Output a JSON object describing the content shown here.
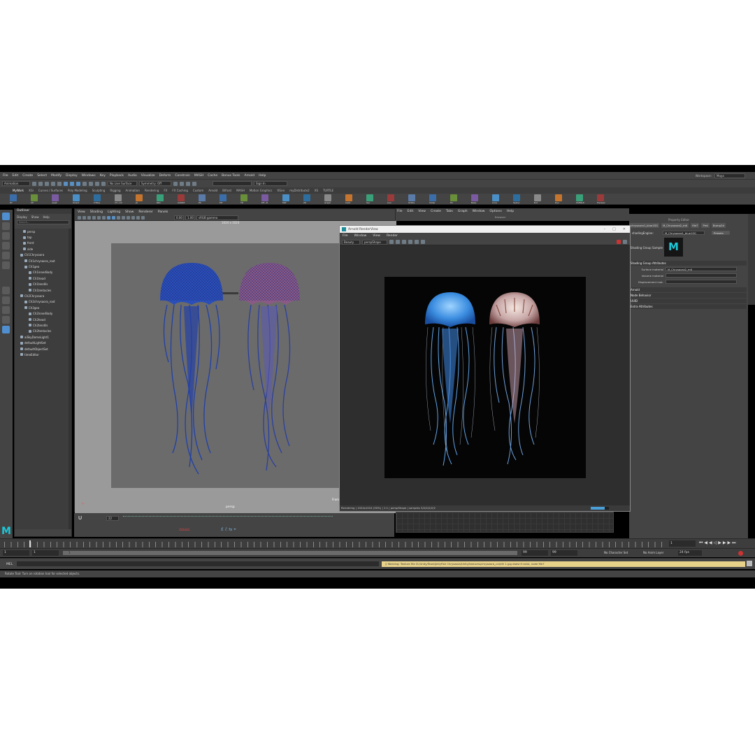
{
  "menubar": [
    "File",
    "Edit",
    "Create",
    "Select",
    "Modify",
    "Display",
    "Windows",
    "Key",
    "Playback",
    "Audio",
    "Visualize",
    "Deform",
    "Constrain",
    "MASH",
    "Cache",
    "Bonus Tools",
    "Arnold",
    "Help"
  ],
  "workspace": {
    "label": "Workspace:",
    "value": "Maya"
  },
  "status_line": {
    "mode": "Animation",
    "live_surface": "No Live Surface",
    "symmetry": "Symmetry: Off",
    "sign_in": "Sign In"
  },
  "shelf_tabs": [
    "MyWork",
    "XGi",
    "Curves / Surfaces",
    "Poly Modeling",
    "Sculpting",
    "Rigging",
    "Animation",
    "Rendering",
    "FX",
    "FX Caching",
    "Custom",
    "Arnold",
    "Bifrost",
    "MASH",
    "Motion Graphics",
    "XGen",
    "myDistribute2",
    "XS",
    "TURTLE"
  ],
  "shelf_labels": [
    "87",
    "CP",
    "reset",
    "Orient",
    "CTRLs",
    "CV~CV",
    "JX",
    "Rfix",
    "CONST",
    "PS",
    "MT",
    "TR",
    "MT~R",
    "MLT",
    "28",
    "Graph",
    "CalcI",
    "Sel",
    "Con",
    "Orbits",
    "Slider",
    "Fin",
    "Bake",
    "Core",
    "Spline",
    "B-U",
    "Dyn",
    "OVERLE",
    "Hanked"
  ],
  "outliner": {
    "title": "Outliner",
    "menu": [
      "Display",
      "Show",
      "Help"
    ],
    "search_placeholder": "Search...",
    "items": [
      "persp",
      "top",
      "front",
      "side",
      "Ch1Chrysaora",
      "Ch1chrysaora_root",
      "Ch1geo",
      "Ch1innerBody",
      "Ch1head",
      "Ch1tendils",
      "Ch1tentacles",
      "Ch2Chrysaora",
      "Ch2chrysaora_root",
      "Ch2geo",
      "Ch2innerBody",
      "Ch2head",
      "Ch2tendils",
      "Ch2tentacles",
      "aiSkyDomeLight1",
      "defaultLightSet",
      "defaultObjectSet",
      "timeEditor"
    ]
  },
  "viewport": {
    "menu": [
      "View",
      "Shading",
      "Lighting",
      "Show",
      "Renderer",
      "Panels"
    ],
    "resolution": "1024 x 1024",
    "gamma_fields": [
      "0.00",
      "1.00"
    ],
    "colorspace": "sRGB gamma",
    "camera": "persp",
    "frame_label": "Frame:"
  },
  "render_view": {
    "title": "Arnold RenderView",
    "menu": [
      "File",
      "Window",
      "View",
      "Render"
    ],
    "aov": "Beauty",
    "camera": "perspShape",
    "status": "Rendering | 1024x1024 (50%) | 1:1 | perspShape | samples 3/2/2/2/2/2",
    "progress": 0.75,
    "progress_label": "75%"
  },
  "hypershade_menu": [
    "File",
    "Edit",
    "View",
    "Create",
    "Tabs",
    "Graph",
    "Window",
    "Options",
    "Help"
  ],
  "hypershade_label": "Browser",
  "attribute_editor": {
    "title": "Property Editor",
    "tabs": [
      "chrysaora1_blue1SG",
      "M_Chrysaora2_mtl",
      "file7",
      "Pmt",
      "Bump2d"
    ],
    "shading_engine_label": "shadingEngine:",
    "shading_engine_value": "M_Chrysaora1_blue1SG",
    "presets": "Presets",
    "sample_label": "Shading Group Sample",
    "logo": "M",
    "section_sg": "Shading Group Attributes",
    "surface_label": "Surface material",
    "surface_value": "M_Chrysaora2_mtl",
    "volume_label": "Volume material",
    "volume_value": "",
    "displacement_label": "Displacement mat.",
    "displacement_value": "",
    "sections": [
      "Arnold",
      "Node Behavior",
      "UUID",
      "Extra Attributes"
    ]
  },
  "timeline": {
    "current_frame": "1",
    "frame_field": "22",
    "range_start": "1",
    "range_start2": "1",
    "range_mid": "1",
    "range_end_inner": "99",
    "range_end": "99",
    "range_end_outer": "99",
    "character_set": "No Character Set",
    "anim_layer": "No Anim Layer",
    "fps": "24 fps"
  },
  "command_line": {
    "lang": "MEL",
    "warning": "// Warning: Texture file D:/Unity/Store/JellyFish Chrysaora/Unity/textures/chrysaora_cut/dV 1.jpg doesn't exist, node file7"
  },
  "help_line": "Rotate Tool: Turn on rotation tool for selected objects.",
  "colors": {
    "accent": "#1ec6d6",
    "selection": "#4f8fcf",
    "warning": "#e8d28a"
  }
}
